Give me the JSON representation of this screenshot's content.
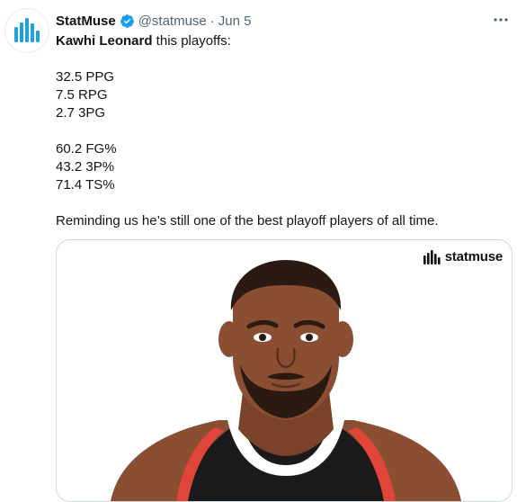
{
  "tweet": {
    "display_name": "StatMuse",
    "handle": "@statmuse",
    "separator": "·",
    "date": "Jun 5",
    "more_label": "···",
    "mention": "Kawhi Leonard",
    "intro_rest": " this playoffs:",
    "stats_group1": [
      "32.5 PPG",
      "7.5 RPG",
      "2.7 3PG"
    ],
    "stats_group2": [
      "60.2 FG%",
      "43.2 3P%",
      "71.4 TS%"
    ],
    "closing": "Reminding us he’s still one of the best playoff players of all time."
  },
  "card": {
    "brand_name": "statmuse"
  },
  "colors": {
    "brand_blue": "#1fa2d4",
    "verified_blue": "#1d9bf0",
    "secondary_text": "#536471",
    "skin": "#8a4f33",
    "hair": "#2b1a12",
    "jersey_black": "#1b1b1b",
    "jersey_red": "#e0453a"
  },
  "icons": {
    "avatar": "statmuse-bars-logo",
    "verified": "verified-badge-icon",
    "more": "more-horizontal-icon",
    "brand": "statmuse-bars-logo"
  }
}
